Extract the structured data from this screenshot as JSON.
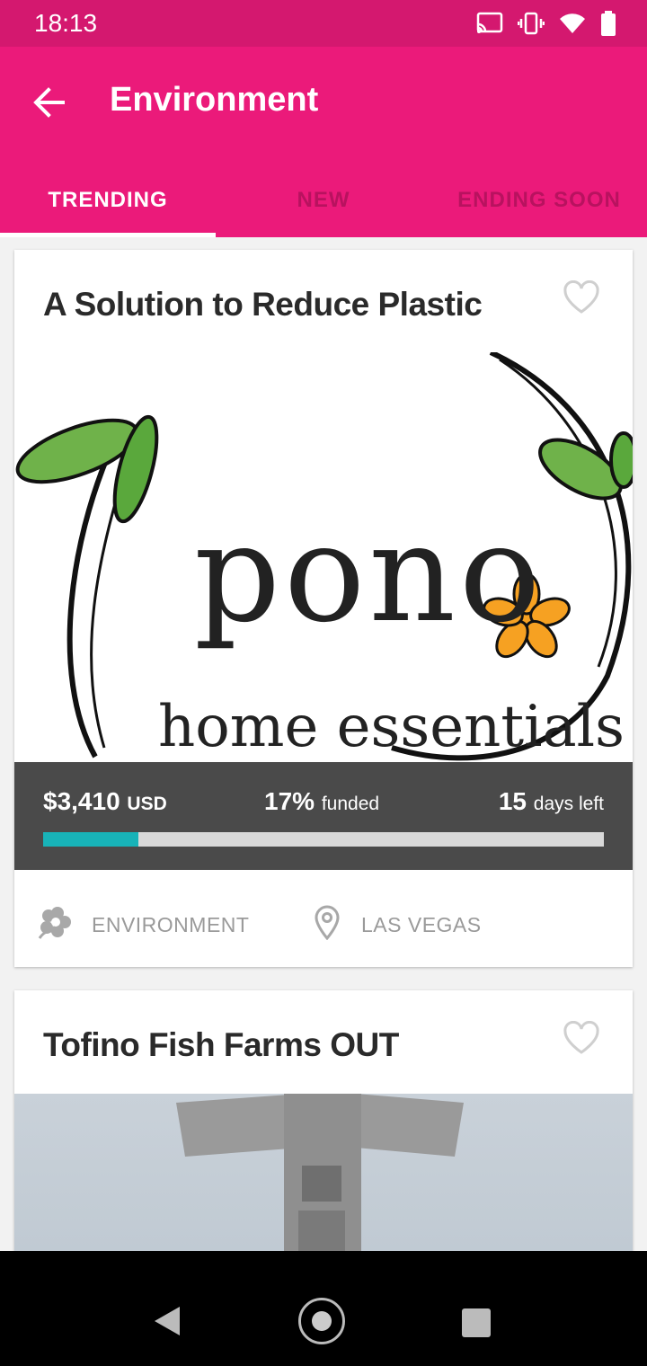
{
  "status_bar": {
    "time": "18:13"
  },
  "app_bar": {
    "title": "Environment"
  },
  "tabs": [
    {
      "label": "TRENDING",
      "active": true
    },
    {
      "label": "NEW",
      "active": false
    },
    {
      "label": "ENDING SOON",
      "active": false
    }
  ],
  "cards": [
    {
      "title": "A Solution to Reduce Plastic",
      "image_text": {
        "word": "pono",
        "sub": "home essentials"
      },
      "amount": "$3,410",
      "currency": "USD",
      "percent": "17%",
      "percent_label": "funded",
      "funded_fraction": 0.17,
      "days": "15",
      "days_label": "days left",
      "category": "ENVIRONMENT",
      "location": "LAS VEGAS",
      "favorited": false
    },
    {
      "title": "Tofino Fish Farms OUT",
      "favorited": false
    }
  ],
  "colors": {
    "status_bar": "#d4186f",
    "app_bar": "#eb1a7a",
    "progress": "#18b3b8",
    "funding_bg": "#4a4a4a"
  },
  "icons": [
    "back-arrow-icon",
    "cast-icon",
    "vibrate-icon",
    "wifi-icon",
    "battery-icon",
    "heart-icon",
    "flower-icon",
    "location-pin-icon"
  ]
}
